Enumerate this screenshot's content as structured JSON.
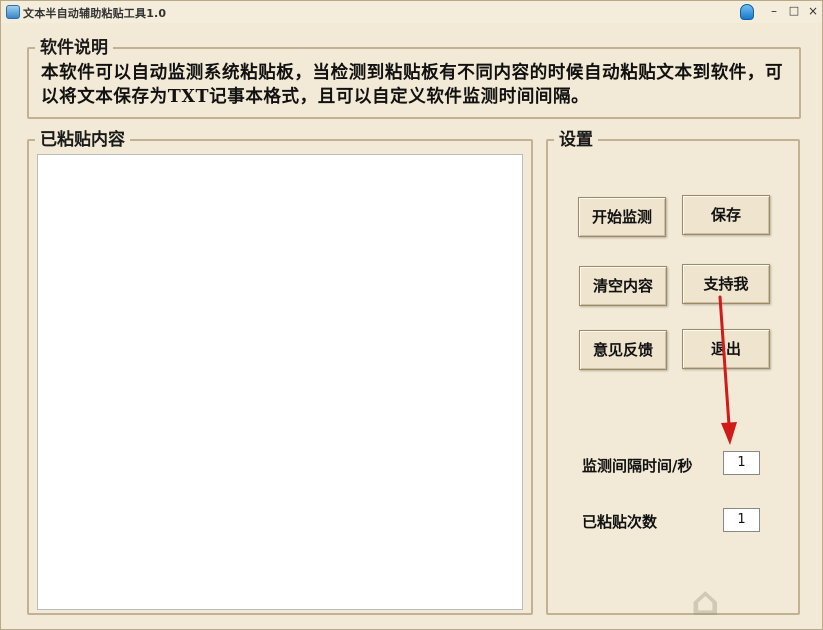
{
  "window": {
    "title": "文本半自动辅助粘贴工具1.0",
    "controls": {
      "minimize": "–",
      "maximize": "□",
      "close": "×"
    }
  },
  "description": {
    "legend": "软件说明",
    "text": "本软件可以自动监测系统粘贴板，当检测到粘贴板有不同内容的时候自动粘贴文本到软件，可以将文本保存为TXT记事本格式，且可以自定义软件监测时间间隔。"
  },
  "content": {
    "legend": "已粘贴内容",
    "value": ""
  },
  "settings": {
    "legend": "设置",
    "buttons": {
      "start": "开始监测",
      "save": "保存",
      "clear": "清空内容",
      "support": "支持我",
      "feedback": "意见反馈",
      "exit": "退出"
    },
    "interval_label": "监测间隔时间/秒",
    "interval_value": "1",
    "count_label": "已粘贴次数",
    "count_value": "1"
  },
  "colors": {
    "background": "#f2ead6",
    "border": "#c2b293",
    "annotation_arrow": "#d11a1a"
  },
  "icons": {
    "app": "app-icon",
    "skin": "skin-shirt-icon",
    "watermark": "watermark-logo"
  }
}
